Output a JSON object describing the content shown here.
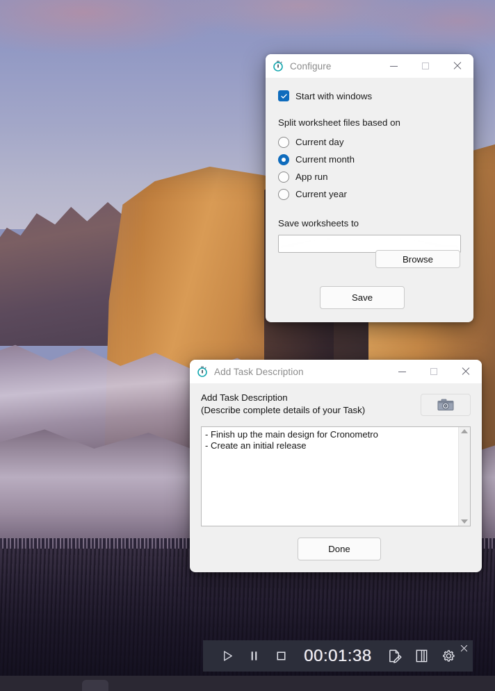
{
  "desktop": {
    "wallpaper_description": "dolomite-mountain-sunrise"
  },
  "configure_window": {
    "title": "Configure",
    "icon": "stopwatch-icon",
    "controls": {
      "minimize": "minimize-icon",
      "maximize": "maximize-icon",
      "close": "close-icon"
    },
    "startup_checkbox": {
      "label": "Start with windows",
      "checked": true
    },
    "split_section_label": "Split worksheet files based on",
    "split_options": [
      {
        "label": "Current day",
        "selected": false
      },
      {
        "label": "Current month",
        "selected": true
      },
      {
        "label": "App run",
        "selected": false
      },
      {
        "label": "Current year",
        "selected": false
      }
    ],
    "save_path_label": "Save worksheets to",
    "save_path_value": "",
    "save_path_placeholder": "",
    "browse_button": "Browse",
    "save_button": "Save"
  },
  "task_window": {
    "title": "Add Task Description",
    "icon": "stopwatch-icon",
    "controls": {
      "minimize": "minimize-icon",
      "maximize": "maximize-icon",
      "close": "close-icon"
    },
    "heading_line1": "Add Task Description",
    "heading_line2": "(Describe complete details of your Task)",
    "camera_button_icon": "camera-icon",
    "description_value": "- Finish up the main design for Cronometro\n- Create an initial release",
    "scrollbar": {
      "up_arrow": "scroll-up-icon",
      "down_arrow": "scroll-down-icon"
    },
    "done_button": "Done"
  },
  "control_bar": {
    "play_icon": "play-icon",
    "pause_icon": "pause-icon",
    "stop_icon": "stop-icon",
    "elapsed_time": "00:01:38",
    "note_icon": "note-edit-icon",
    "split_icon": "split-column-icon",
    "settings_icon": "gear-icon",
    "close_icon": "close-icon"
  },
  "colors": {
    "accent": "#0f6cbd",
    "window_bg": "#f0f0f0",
    "titlebar_bg": "#ffffff",
    "title_text": "#8b8b8b",
    "control_bar_bg": "#2e303c",
    "taskbar_bg": "#2b2833",
    "stopwatch_icon": "#16a8b0"
  }
}
